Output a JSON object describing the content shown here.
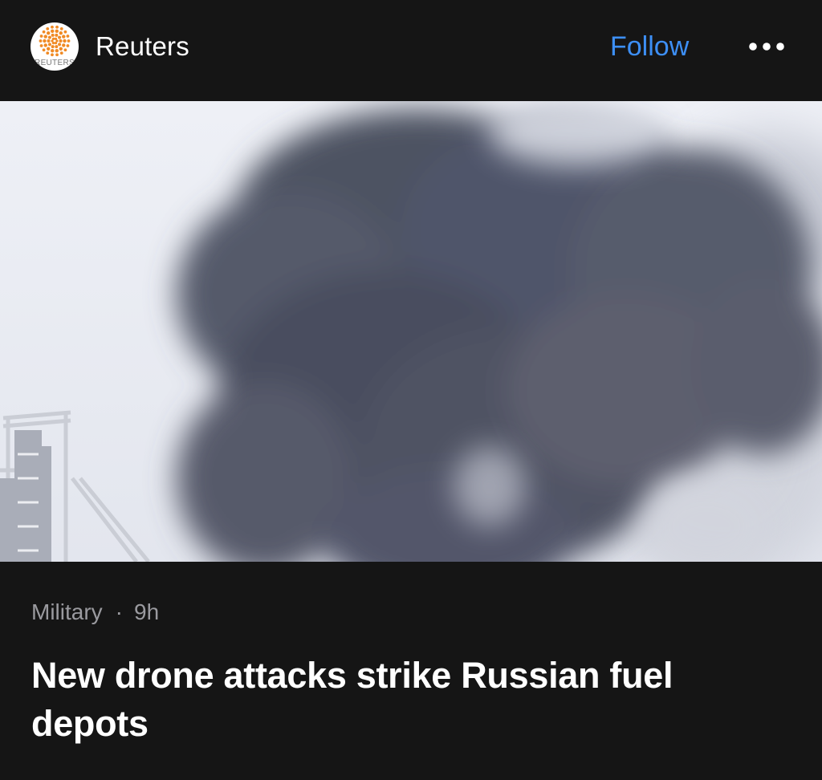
{
  "header": {
    "publisher": "Reuters",
    "logo_text": "REUTERS",
    "follow_label": "Follow",
    "more_icon": "ellipsis-icon"
  },
  "hero": {
    "image_description": "dark smoke plume over industrial structure"
  },
  "article": {
    "category": "Military",
    "separator": "·",
    "age": "9h",
    "headline": "New drone attacks strike Russian fuel depots"
  },
  "colors": {
    "background": "#151515",
    "accent": "#3d8ff5",
    "meta_text": "#9a9a9f",
    "logo_orange": "#f08a24"
  }
}
